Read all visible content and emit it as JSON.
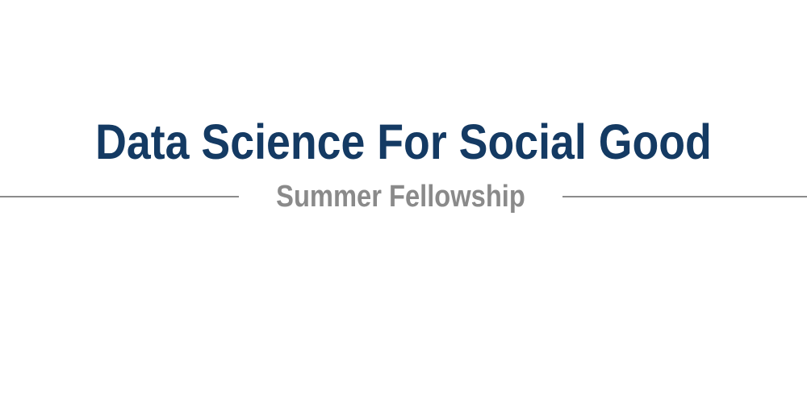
{
  "logo": {
    "title": "Data Science For Social Good",
    "subtitle": "Summer Fellowship",
    "colors": {
      "title": "#143a63",
      "subtitle": "#8a8a8a",
      "rule": "#8c8c8c",
      "background": "#ffffff"
    }
  }
}
